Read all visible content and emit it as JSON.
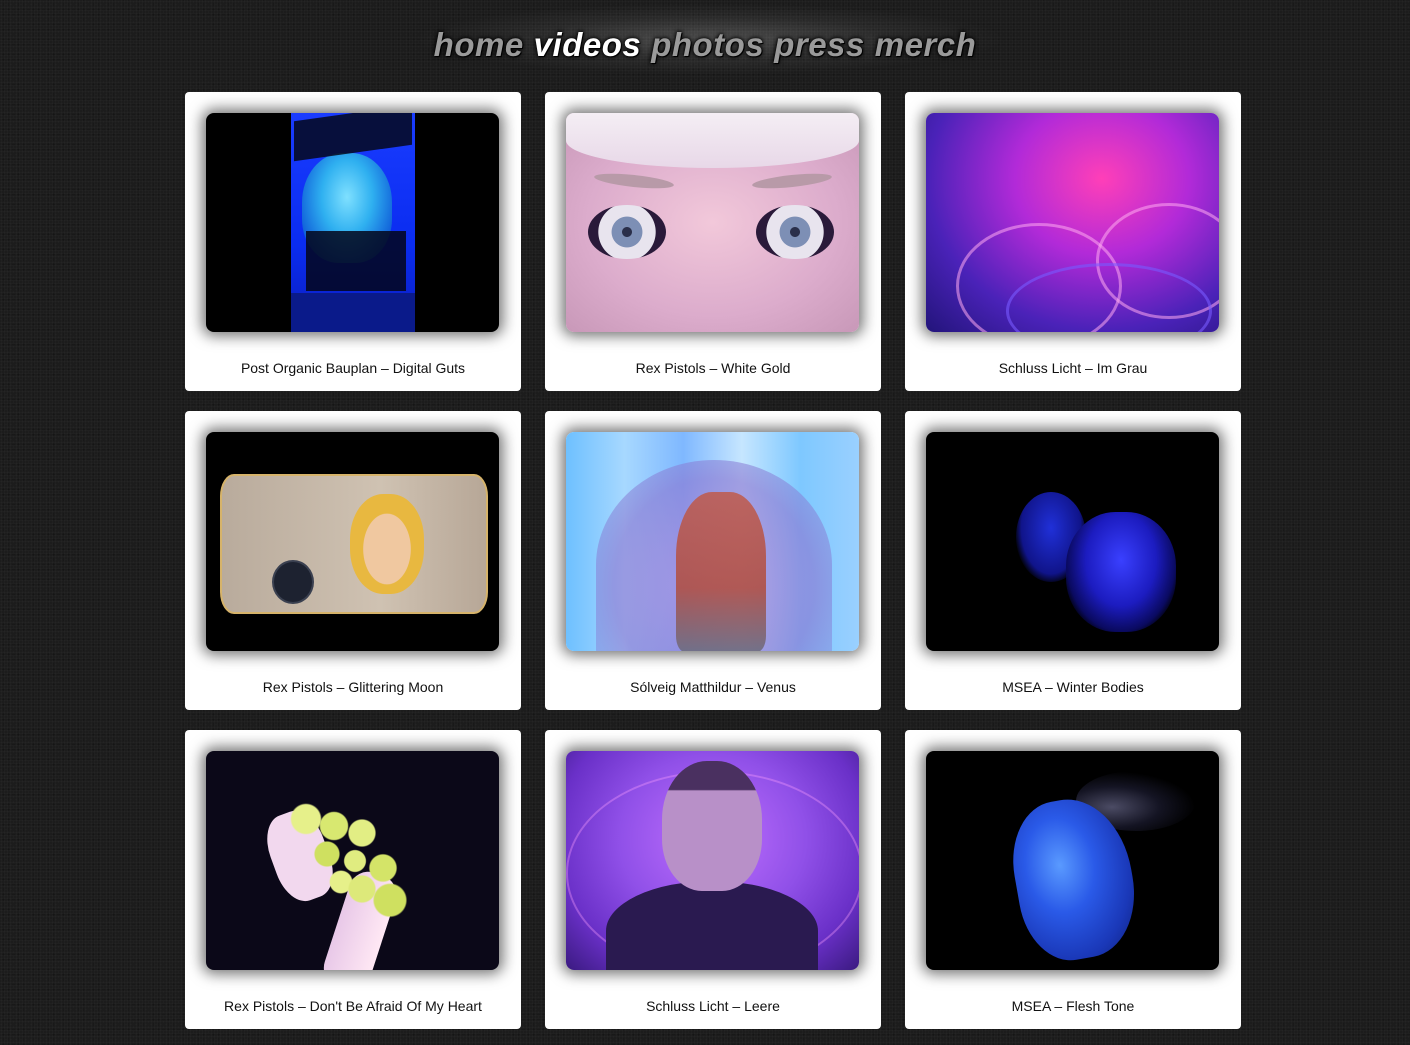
{
  "nav": {
    "items": [
      {
        "label": "home",
        "active": false
      },
      {
        "label": "videos",
        "active": true
      },
      {
        "label": "photos",
        "active": false
      },
      {
        "label": "press",
        "active": false
      },
      {
        "label": "merch",
        "active": false
      }
    ]
  },
  "videos": [
    {
      "caption": "Post Organic Bauplan – Digital Guts"
    },
    {
      "caption": "Rex Pistols – White Gold"
    },
    {
      "caption": "Schluss Licht – Im Grau"
    },
    {
      "caption": "Rex Pistols – Glittering Moon"
    },
    {
      "caption": "Sólveig Matthildur – Venus"
    },
    {
      "caption": "MSEA – Winter Bodies"
    },
    {
      "caption": "Rex Pistols – Don't Be Afraid Of My Heart"
    },
    {
      "caption": "Schluss Licht – Leere"
    },
    {
      "caption": "MSEA – Flesh Tone"
    }
  ],
  "colors": {
    "background": "#1c1c1c",
    "nav_inactive": "#9a9a9a",
    "nav_active": "#ffffff",
    "card": "#ffffff"
  }
}
